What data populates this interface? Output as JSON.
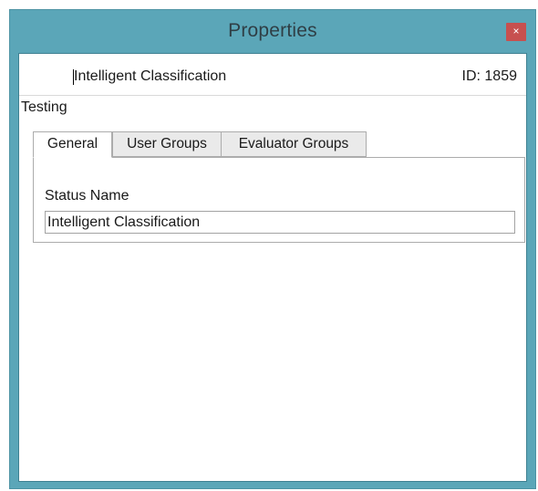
{
  "window": {
    "title": "Properties",
    "close_glyph": "×"
  },
  "header": {
    "record_name": "Intelligent Classification",
    "record_id": "ID: 1859"
  },
  "section": {
    "label": "Testing"
  },
  "tabs": [
    {
      "label": "General",
      "active": true
    },
    {
      "label": "User Groups",
      "active": false
    },
    {
      "label": "Evaluator Groups",
      "active": false
    }
  ],
  "general": {
    "status_name_label": "Status Name",
    "status_name_value": "Intelligent Classification"
  },
  "colors": {
    "chrome": "#5ba6b8",
    "close_button": "#c7504f"
  }
}
